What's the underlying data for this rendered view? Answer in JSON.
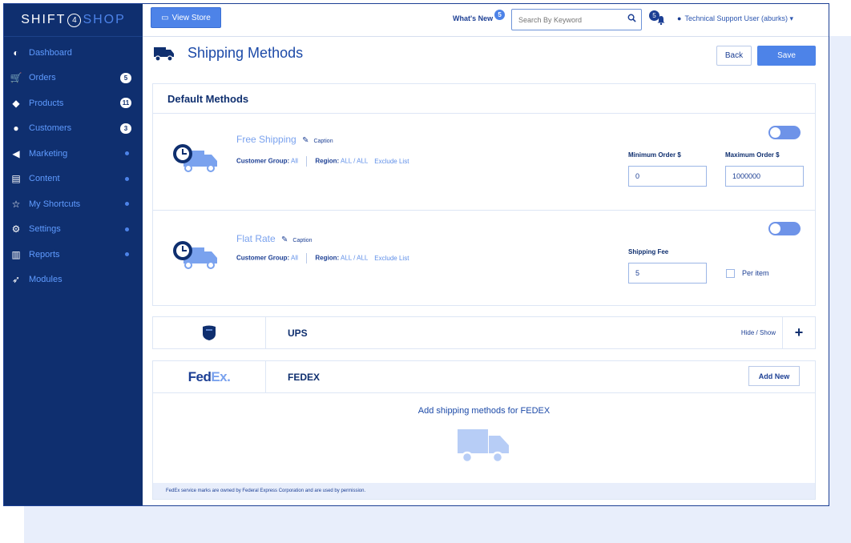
{
  "brand": {
    "left": "SHIFT",
    "num": "4",
    "right": "SHOP"
  },
  "sidebar": {
    "items": [
      {
        "label": "Dashboard",
        "icon": "dashboard-icon",
        "glyph": "◐",
        "badge": ""
      },
      {
        "label": "Orders",
        "icon": "cart-icon",
        "glyph": "🛒",
        "badge": "5"
      },
      {
        "label": "Products",
        "icon": "tags-icon",
        "glyph": "◆",
        "badge": "11"
      },
      {
        "label": "Customers",
        "icon": "user-icon",
        "glyph": "●",
        "badge": "3"
      },
      {
        "label": "Marketing",
        "icon": "megaphone-icon",
        "glyph": "◀",
        "badge": ""
      },
      {
        "label": "Content",
        "icon": "document-icon",
        "glyph": "▤",
        "badge": ""
      },
      {
        "label": "My Shortcuts",
        "icon": "star-icon",
        "glyph": "☆",
        "badge": ""
      },
      {
        "label": "Settings",
        "icon": "gears-icon",
        "glyph": "⚙",
        "badge": ""
      },
      {
        "label": "Reports",
        "icon": "bar-chart-icon",
        "glyph": "▥",
        "badge": ""
      },
      {
        "label": "Modules",
        "icon": "rocket-icon",
        "glyph": "➶",
        "badge": ""
      }
    ]
  },
  "topbar": {
    "view_store": "View Store",
    "whats_new": "What's New",
    "whats_new_badge": "5",
    "search_placeholder": "Search By Keyword",
    "notif_badge": "5",
    "user": "Technical Support User (aburks) ▾"
  },
  "page": {
    "title": "Shipping Methods",
    "back_label": "Back",
    "save_label": "Save"
  },
  "default_methods": {
    "heading": "Default Methods",
    "free": {
      "name": "Free Shipping",
      "caption": "Caption",
      "group_label": "Customer Group:",
      "group_value": "All",
      "region_label": "Region:",
      "region_value": "ALL / ALL",
      "exclude": "Exclude List",
      "min_label": "Minimum Order $",
      "min_value": "0",
      "max_label": "Maximum Order $",
      "max_value": "1000000"
    },
    "flat": {
      "name": "Flat Rate",
      "caption": "Caption",
      "group_label": "Customer Group:",
      "group_value": "All",
      "region_label": "Region:",
      "region_value": "ALL / ALL",
      "exclude": "Exclude List",
      "fee_label": "Shipping Fee",
      "fee_value": "5",
      "per_item": "Per item"
    }
  },
  "ups": {
    "name": "UPS",
    "hide_show": "Hide / Show",
    "plus": "+"
  },
  "fedex": {
    "logo_fed": "Fed",
    "logo_ex": "Ex.",
    "name": "FEDEX",
    "add_new": "Add New",
    "empty_msg": "Add shipping methods for FEDEX",
    "footnote": "FedEx service marks are owned by Federal Express Corporation and are used by permission."
  },
  "colors": {
    "sidebar": "#0f2f6f",
    "accent": "#4d83e8",
    "text": "#1c3f94"
  }
}
